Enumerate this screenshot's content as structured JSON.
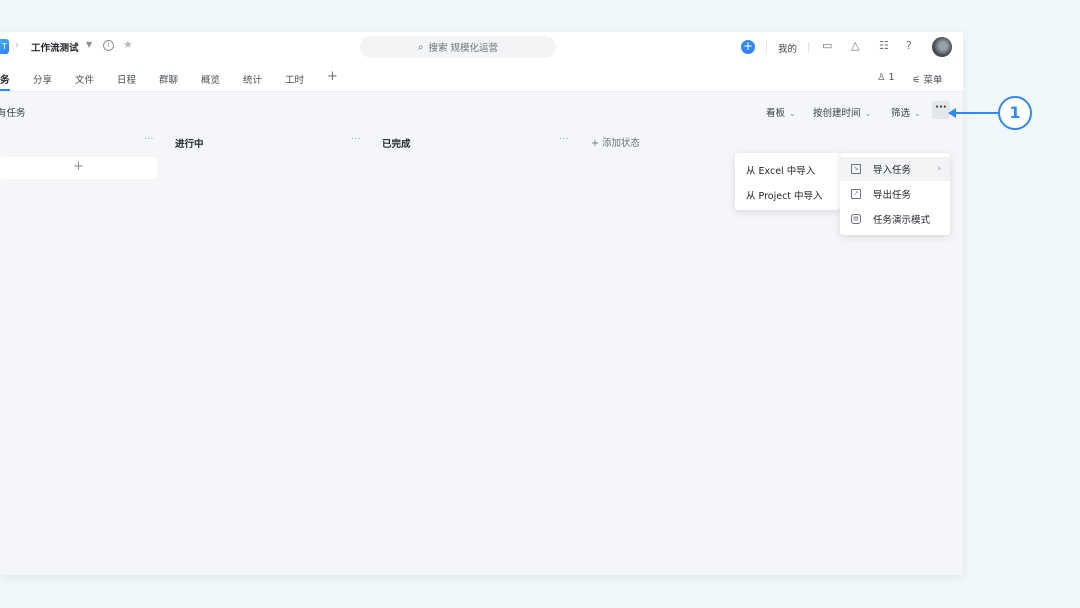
{
  "topbar": {
    "logo_text": "T",
    "project_title": "工作流测试",
    "search_placeholder": "搜索 规模化运营",
    "mine_label": "我的",
    "add_glyph": "+"
  },
  "tabs": [
    {
      "label": "务"
    },
    {
      "label": "分享"
    },
    {
      "label": "文件"
    },
    {
      "label": "日程"
    },
    {
      "label": "群聊"
    },
    {
      "label": "概览"
    },
    {
      "label": "统计"
    },
    {
      "label": "工时"
    }
  ],
  "tabbar_right": {
    "member_count": "1",
    "menu_label": "菜单"
  },
  "toolbar": {
    "left_label": "有任务",
    "view_label": "看板",
    "sort_label": "按创建时间",
    "filter_label": "筛选"
  },
  "columns": [
    {
      "title": "进行中"
    },
    {
      "title": "已完成"
    }
  ],
  "add_status_label": "添加状态",
  "more_menu": {
    "items": [
      {
        "label": "导入任务"
      },
      {
        "label": "导出任务"
      },
      {
        "label": "任务演示模式"
      }
    ]
  },
  "import_submenu": {
    "items": [
      {
        "label": "从 Excel 中导入"
      },
      {
        "label": "从 Project 中导入"
      }
    ]
  },
  "callout": {
    "number": "1"
  },
  "colors": {
    "accent": "#2f88ff",
    "page_bg": "#f1f8fb",
    "board_bg": "#f5f6f9"
  }
}
